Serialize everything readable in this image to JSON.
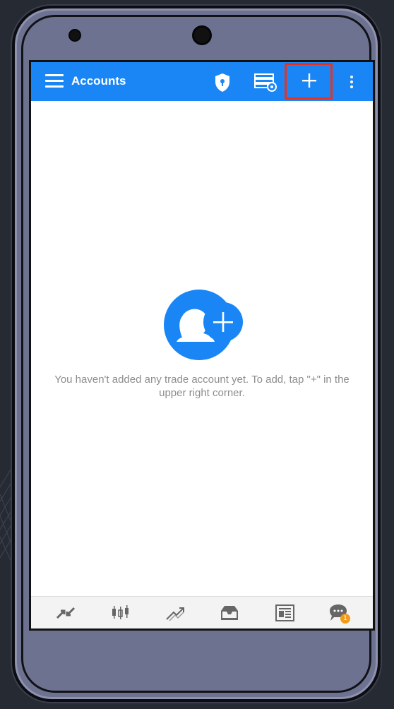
{
  "appbar": {
    "menu_icon": "hamburger-menu-icon",
    "title": "Accounts",
    "actions": [
      {
        "name": "shield-icon"
      },
      {
        "name": "server-settings-icon"
      },
      {
        "name": "plus-icon",
        "highlighted": true,
        "highlight_color": "#e8321f"
      },
      {
        "name": "more-vertical-icon"
      }
    ],
    "color": "#1a86f6"
  },
  "empty_state": {
    "icon": "add-account-icon",
    "message": "You haven't added any trade account yet. To add, tap \"+\" in the upper right corner."
  },
  "bottom_nav": {
    "tabs": [
      {
        "name": "quotes-icon"
      },
      {
        "name": "chart-icon"
      },
      {
        "name": "trade-icon"
      },
      {
        "name": "history-icon"
      },
      {
        "name": "news-icon"
      },
      {
        "name": "messages-icon",
        "badge": "1"
      }
    ],
    "badge_color": "#f29a1a"
  }
}
